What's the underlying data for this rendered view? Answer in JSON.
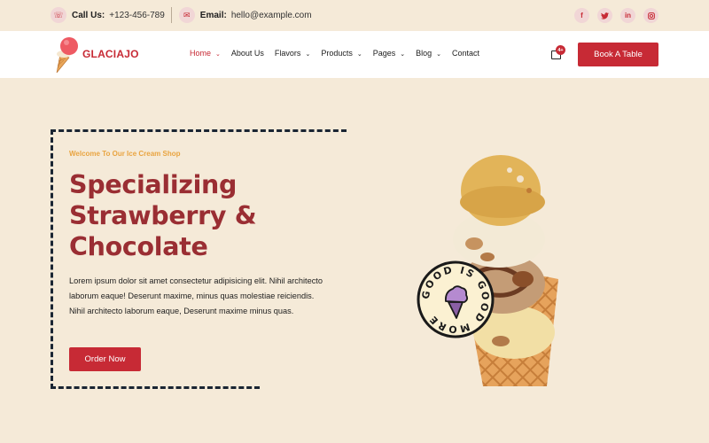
{
  "topbar": {
    "phone_icon": "phone-icon",
    "phone_label": "Call Us:",
    "phone_value": "+123-456-789",
    "email_icon": "mail-icon",
    "email_label": "Email:",
    "email_value": "hello@example.com",
    "socials": [
      {
        "name": "facebook-icon",
        "glyph": "f"
      },
      {
        "name": "twitter-icon",
        "glyph": "🐦"
      },
      {
        "name": "linkedin-icon",
        "glyph": "in"
      },
      {
        "name": "instagram-icon",
        "glyph": "◎"
      }
    ]
  },
  "header": {
    "brand": "GLACIAJO",
    "nav": [
      {
        "label": "Home",
        "dropdown": true,
        "active": true
      },
      {
        "label": "About Us",
        "dropdown": false,
        "active": false
      },
      {
        "label": "Flavors",
        "dropdown": true,
        "active": false
      },
      {
        "label": "Products",
        "dropdown": true,
        "active": false
      },
      {
        "label": "Pages",
        "dropdown": true,
        "active": false
      },
      {
        "label": "Blog",
        "dropdown": true,
        "active": false
      },
      {
        "label": "Contact",
        "dropdown": false,
        "active": false
      }
    ],
    "cart_badge": "4+",
    "book_button": "Book A Table"
  },
  "hero": {
    "eyebrow": "Welcome To Our Ice Cream Shop",
    "title_lines": [
      "Specializing",
      "Strawberry &",
      "Chocolate"
    ],
    "text": "Lorem ipsum dolor sit amet consectetur adipisicing elit. Nihil architecto laborum eaque! Deserunt maxime, minus quas molestiae reiciendis. Nihil architecto laborum eaque, Deserunt maxime minus quas.",
    "order_button": "Order Now",
    "sticker_text": "GOOD IS GOOD MORE "
  },
  "colors": {
    "brand_red": "#c72a35",
    "title_red": "#9a2e33",
    "accent_orange": "#e9a440",
    "background_cream": "#f5ead8",
    "dash_navy": "#1a2533"
  }
}
